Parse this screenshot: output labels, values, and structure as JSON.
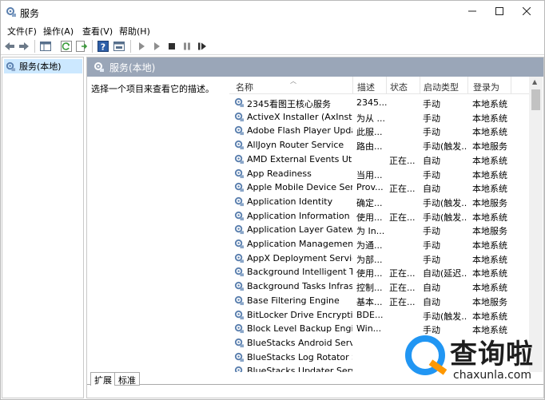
{
  "window": {
    "title": "服务"
  },
  "menu": [
    {
      "label": "文件(F)"
    },
    {
      "label": "操作(A)"
    },
    {
      "label": "查看(V)"
    },
    {
      "label": "帮助(H)"
    }
  ],
  "tree": {
    "item": "服务(本地)"
  },
  "panel": {
    "header": "服务(本地)",
    "description": "选择一个项目来查看它的描述。"
  },
  "columns": [
    "名称",
    "描述",
    "状态",
    "启动类型",
    "登录为"
  ],
  "services": [
    {
      "name": "2345看图王核心服务",
      "desc": "2345...",
      "status": "",
      "start": "手动",
      "logon": "本地系统"
    },
    {
      "name": "ActiveX Installer (AxInstSV)",
      "desc": "为从 ...",
      "status": "",
      "start": "手动",
      "logon": "本地系统"
    },
    {
      "name": "Adobe Flash Player Upda...",
      "desc": "此服...",
      "status": "",
      "start": "手动",
      "logon": "本地系统"
    },
    {
      "name": "AllJoyn Router Service",
      "desc": "路由...",
      "status": "",
      "start": "手动(触发...",
      "logon": "本地服务"
    },
    {
      "name": "AMD External Events Utility",
      "desc": "",
      "status": "正在...",
      "start": "自动",
      "logon": "本地系统"
    },
    {
      "name": "App Readiness",
      "desc": "当用...",
      "status": "",
      "start": "手动",
      "logon": "本地系统"
    },
    {
      "name": "Apple Mobile Device Ser...",
      "desc": "Prov...",
      "status": "正在...",
      "start": "自动",
      "logon": "本地系统"
    },
    {
      "name": "Application Identity",
      "desc": "确定...",
      "status": "",
      "start": "手动(触发...",
      "logon": "本地服务"
    },
    {
      "name": "Application Information",
      "desc": "使用...",
      "status": "正在...",
      "start": "手动(触发...",
      "logon": "本地系统"
    },
    {
      "name": "Application Layer Gatewa...",
      "desc": "为 In...",
      "status": "",
      "start": "手动",
      "logon": "本地服务"
    },
    {
      "name": "Application Management",
      "desc": "为通...",
      "status": "",
      "start": "手动",
      "logon": "本地系统"
    },
    {
      "name": "AppX Deployment Servic...",
      "desc": "为部...",
      "status": "",
      "start": "手动",
      "logon": "本地系统"
    },
    {
      "name": "Background Intelligent T...",
      "desc": "使用...",
      "status": "正在...",
      "start": "自动(延迟...",
      "logon": "本地系统"
    },
    {
      "name": "Background Tasks Infras...",
      "desc": "控制...",
      "status": "正在...",
      "start": "自动",
      "logon": "本地系统"
    },
    {
      "name": "Base Filtering Engine",
      "desc": "基本...",
      "status": "正在...",
      "start": "自动",
      "logon": "本地服务"
    },
    {
      "name": "BitLocker Drive Encryptio...",
      "desc": "BDE...",
      "status": "",
      "start": "手动(触发...",
      "logon": "本地系统"
    },
    {
      "name": "Block Level Backup Engi...",
      "desc": "Win...",
      "status": "",
      "start": "手动",
      "logon": "本地系统"
    },
    {
      "name": "BlueStacks Android Servi...",
      "desc": "",
      "status": "",
      "start": "",
      "logon": ""
    },
    {
      "name": "BlueStacks Log Rotator S...",
      "desc": "",
      "status": "",
      "start": "",
      "logon": ""
    },
    {
      "name": "BlueStacks Updater Servi...",
      "desc": "",
      "status": "",
      "start": "",
      "logon": ""
    }
  ],
  "tabs": [
    {
      "label": "扩展"
    },
    {
      "label": "标准"
    }
  ],
  "watermark": {
    "text": "查询啦",
    "sub": "chaxunla.com"
  },
  "colors": {
    "panel_header": "#9aa6b8",
    "selection": "#cce8ff",
    "gear": "#5a7fae"
  }
}
